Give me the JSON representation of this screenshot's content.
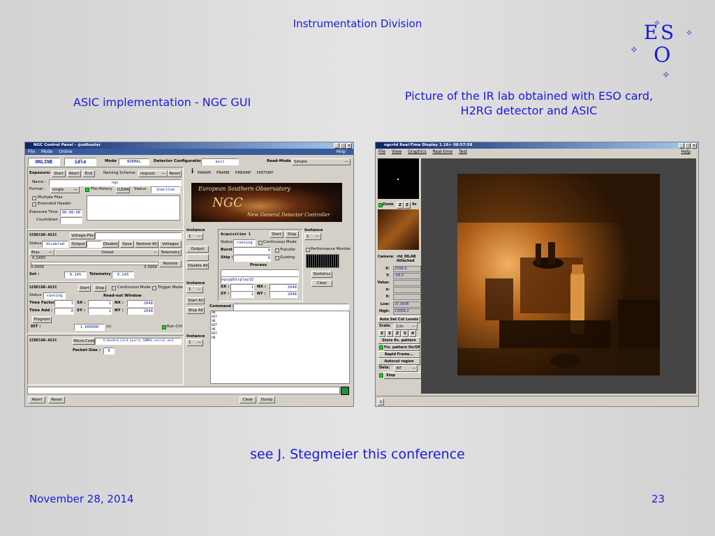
{
  "slide": {
    "header": "Instrumentation Division",
    "left_caption": "ASIC implementation - NGC GUI",
    "right_caption_line1": "Picture of the IR lab obtained with ESO card,",
    "right_caption_line2": "H2RG detector and ASIC",
    "bottom_note": "see J. Stegmeier this conference",
    "date": "November 28, 2014",
    "page_number": "23",
    "logo": {
      "letters": [
        "E",
        "S",
        "O"
      ],
      "stars": "✧"
    },
    "text_color": "#1a1adc"
  },
  "ngc": {
    "title": "NGC Control Panel - @odhoster",
    "menu": [
      "File",
      "Mode",
      "Online"
    ],
    "help": "Help",
    "top": {
      "online": "ONLINE",
      "state": "idle",
      "mode_label": "Mode",
      "mode_value": "NORMAL",
      "detcfg_label": "Detector Configuration",
      "detcfg_value": "asic",
      "readmode_label": "Read-Mode",
      "readmode_value": "Simple"
    },
    "exposure": {
      "label": "Exposure:",
      "start": "Start",
      "abort": "Abort",
      "end": "End",
      "naming_label": "Naming Scheme:",
      "naming_value": "request",
      "reset": "Reset",
      "name_label": "Name :",
      "name_value": "ngc",
      "format_label": "Format :",
      "format_value": "single",
      "file_history": "File-History",
      "clear": "CLEAR",
      "status_label": "Status",
      "status_value": "inactive",
      "multiple_files": "Multiple Files",
      "extended_header": "Extended Header",
      "exp_time_label": "Exposure Time",
      "exp_time_value": "00:00:00",
      "countdown_label": "Countdown"
    },
    "tabs": [
      "PARAM",
      "FRAME",
      "PREAMP",
      "HISTORY"
    ],
    "banner": {
      "line1": "European Southern Observatory",
      "big": "NGC",
      "line2": "New General Detector Controller"
    },
    "sidecar1": {
      "name": "SIDECAR-ASIC",
      "voltage_file": "Voltage-File",
      "status_label": "Status",
      "status_value": "disabled",
      "output": "Output",
      "disable": "Disable",
      "save": "Save",
      "restore_all": "Restore All",
      "voltages": "Voltages",
      "bias": "Bias",
      "vreset": "Vreset",
      "telemetry": "Telemetry",
      "v1": "0.1450",
      "v2": "0.0000",
      "v3": "3.3000",
      "restore": "Restore",
      "set_label": "Set :",
      "set_value": "0.145",
      "tel_label": "Telemetry :",
      "tel_value": "0.145"
    },
    "sidecar2": {
      "name": "SIDECAR-ASIC",
      "start": "Start",
      "stop": "Stop",
      "cont_mode": "Continuous Mode",
      "trig_mode": "Trigger Mode",
      "status_label": "Status",
      "status_value": "running",
      "readout": "Read-out Window",
      "tf_label": "Time Factor :",
      "tf_value": "1",
      "ta_label": "Time Add :",
      "ta_value": "0",
      "sx_label": "SX :",
      "sx_value": "1",
      "nx_label": "NX :",
      "nx_value": "2048",
      "sy_label": "SY :",
      "sy_value": "1",
      "ny_label": "NY :",
      "ny_value": "2048",
      "program": "Program",
      "dit_label": "DIT :",
      "dit_value": "1.000000",
      "dit_unit": "(s)",
      "runctrl": "Run-Ctrl"
    },
    "sidecar3": {
      "name": "SIDECAR-ASIC",
      "microcode": "Micro-Code",
      "microcode_value": "H_Dev8rd_Cold_hyorsi_50MHz_serial_mcd",
      "packet_label": "Packet-Size :",
      "packet_value": "8"
    },
    "instance": {
      "label": "Instance",
      "value": "1"
    },
    "mid_buttons": [
      "Output",
      "Disable All",
      "Start All",
      "Stop All"
    ],
    "acq": {
      "name": "Acquisition 1",
      "start": "Start",
      "stop": "Stop",
      "status_label": "Status",
      "status_value": "running",
      "cont_mode": "Continuous Mode",
      "burst_label": "Burst :",
      "burst_value": "0",
      "transfer": "Transfer",
      "skip_label": "Skip :",
      "skip_value": "0",
      "guiding": "Guiding",
      "process": "Process",
      "process_value": "ngcppDisplay32",
      "statistics": "Statistics",
      "clear": "Clear",
      "perf": "Performance Monitor",
      "sx_label": "SX :",
      "sx_value": "1",
      "nx_label": "NX :",
      "nx_value": "2048",
      "sy_label": "SY :",
      "sy_value": "1",
      "ny_label": "NY :",
      "ny_value": "2048"
    },
    "command_label": "Command :",
    "log": [
      "OK",
      "",
      "DET",
      "OK",
      "",
      "DET",
      "OK",
      "",
      "DET",
      "OK"
    ],
    "bottom": [
      "Abort",
      "Reset",
      "Clear",
      "Dump"
    ]
  },
  "rtd": {
    "title": "ngcrtd Real-Time Display 1.16+  08:57:58",
    "menu": [
      "File",
      "View",
      "Graphics",
      "Real-time",
      "Test"
    ],
    "help": "Help",
    "zoom_label": "Zoom",
    "zoom_factor": "4x",
    "camera_label": "Camera:",
    "camera_value": "rtd_IRLAB",
    "camera_status": "Attached",
    "fields": [
      {
        "label": "X:",
        "value": "2358.0"
      },
      {
        "label": "Y:",
        "value": "-58.0"
      },
      {
        "label": "Value:",
        "value": ""
      },
      {
        "label": "α:",
        "value": ""
      },
      {
        "label": "δ:",
        "value": ""
      }
    ],
    "low_label": "Low:",
    "low_value": "37.0696",
    "high_label": "High:",
    "high_value": "13668.2",
    "auto_cuts": "Auto Set Cut Levels",
    "scale_label": "Scale:",
    "scale_value": "1/2x",
    "buttons": [
      "Store fix. pattern",
      "Fix. pattern On/Off",
      "Rapid Frame...",
      "Autocut region"
    ],
    "data_label": "Data:",
    "data_value": "INT",
    "stop": "Stop",
    "photo_colors": {
      "bg": "#2a1504",
      "mid": "#7a3c0a",
      "light": "#e89a3a"
    }
  }
}
